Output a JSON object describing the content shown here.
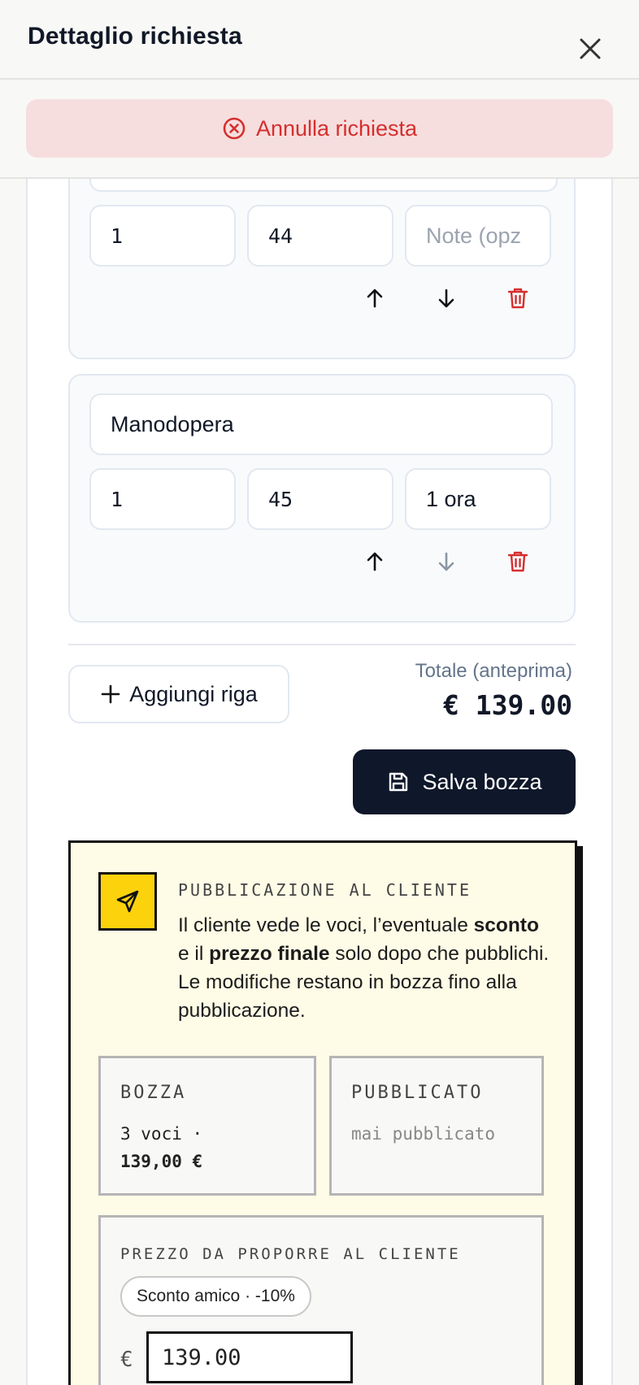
{
  "header": {
    "title": "Dettaglio richiesta",
    "close_icon": "close-icon"
  },
  "cancel": {
    "label": "Annulla richiesta",
    "icon": "x-circle-icon",
    "color": "#d62e2e",
    "bg": "#f6dede"
  },
  "rows": [
    {
      "description": "",
      "quantity": "1",
      "price": "44",
      "note_value": "",
      "note_placeholder": "Note (opz"
    },
    {
      "description": "Manodopera",
      "quantity": "1",
      "price": "45",
      "note_value": "1 ora",
      "note_placeholder": ""
    }
  ],
  "actions": {
    "add_row_label": "Aggiungi riga",
    "save_label": "Salva bozza"
  },
  "total": {
    "label": "Totale (anteprima)",
    "value": "€ 139.00"
  },
  "publication": {
    "title": "PUBBLICAZIONE AL CLIENTE",
    "text_1": "Il cliente vede le voci, l’eventuale ",
    "text_bold_1": "sconto",
    "text_2": " e il ",
    "text_bold_2": "prezzo finale",
    "text_3": " solo dopo che pubblichi. Le modifiche restano in bozza fino alla pubblicazione.",
    "draft_label": "BOZZA",
    "draft_line_1": "3 voci ·",
    "draft_line_2": "139,00 €",
    "published_label": "PUBBLICATO",
    "published_value": "mai pubblicato",
    "price_title": "PREZZO DA PROPORRE AL CLIENTE",
    "discount_chip": "Sconto amico · -10%",
    "currency": "€",
    "price_value": "139.00",
    "accent": "#fcd20d"
  }
}
